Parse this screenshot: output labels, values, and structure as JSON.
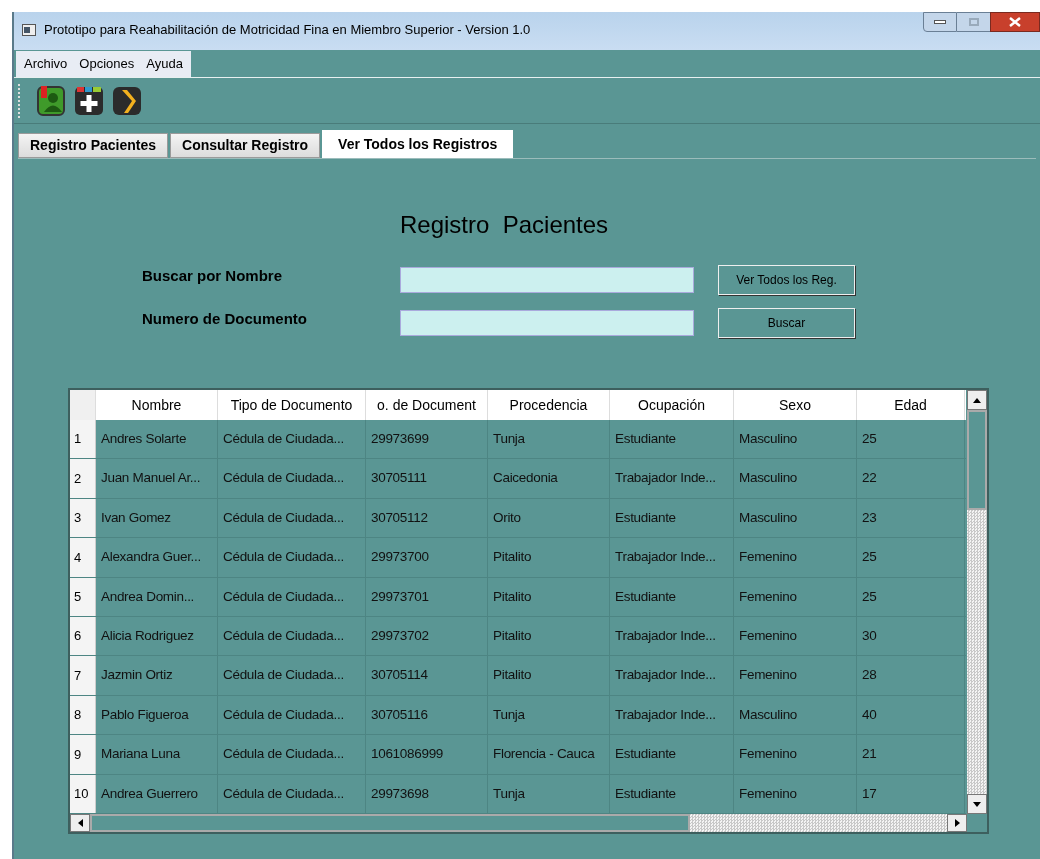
{
  "window": {
    "title": "Prototipo para Reahabilitación de Motricidad Fina en Miembro Superior - Version 1.0"
  },
  "menu": [
    "Archivo",
    "Opciones",
    "Ayuda"
  ],
  "tabs": [
    {
      "label": "Registro Pacientes",
      "selected": false
    },
    {
      "label": "Consultar Registro",
      "selected": false
    },
    {
      "label": "Ver Todos los Registros",
      "selected": true
    }
  ],
  "heading": "Registro  Pacientes",
  "fields": [
    {
      "label": "Buscar por Nombre",
      "button": "Ver Todos los Reg."
    },
    {
      "label": "Numero de Documento",
      "button": "Buscar"
    }
  ],
  "table": {
    "columns": [
      "Nombre",
      "Tipo de Documento",
      "o. de Document",
      "Procedencia",
      "Ocupación",
      "Sexo",
      "Edad"
    ],
    "rows": [
      {
        "number": "1",
        "cells": [
          "Andres Solarte",
          "Cédula de Ciudada...",
          "29973699",
          "Tunja",
          "Estudiante",
          "Masculino",
          "25"
        ]
      },
      {
        "number": "2",
        "cells": [
          "Juan Manuel Ar...",
          "Cédula de Ciudada...",
          "30705111",
          "Caicedonia",
          "Trabajador Inde...",
          "Masculino",
          "22"
        ]
      },
      {
        "number": "3",
        "cells": [
          "Ivan Gomez",
          "Cédula de Ciudada...",
          "30705112",
          "Orito",
          "Estudiante",
          "Masculino",
          "23"
        ]
      },
      {
        "number": "4",
        "cells": [
          "Alexandra Guer...",
          "Cédula de Ciudada...",
          "29973700",
          "Pitalito",
          "Trabajador Inde...",
          "Femenino",
          "25"
        ]
      },
      {
        "number": "5",
        "cells": [
          "Andrea Domin...",
          "Cédula de Ciudada...",
          "29973701",
          "Pitalito",
          "Estudiante",
          "Femenino",
          "25"
        ]
      },
      {
        "number": "6",
        "cells": [
          "Alicia Rodriguez",
          "Cédula de Ciudada...",
          "29973702",
          "Pitalito",
          "Trabajador Inde...",
          "Femenino",
          "30"
        ]
      },
      {
        "number": "7",
        "cells": [
          "Jazmin Ortiz",
          "Cédula de Ciudada...",
          "30705114",
          "Pitalito",
          "Trabajador Inde...",
          "Femenino",
          "28"
        ]
      },
      {
        "number": "8",
        "cells": [
          "Pablo Figueroa",
          "Cédula de Ciudada...",
          "30705116",
          "Tunja",
          "Trabajador Inde...",
          "Masculino",
          "40"
        ]
      },
      {
        "number": "9",
        "cells": [
          "Mariana Luna",
          "Cédula de Ciudada...",
          "1061086999",
          "Florencia - Cauca",
          "Estudiante",
          "Femenino",
          "21"
        ]
      },
      {
        "number": "10",
        "cells": [
          "Andrea Guerrero",
          "Cédula de Ciudada...",
          "29973698",
          "Tunja",
          "Estudiante",
          "Femenino",
          "17"
        ]
      }
    ]
  }
}
